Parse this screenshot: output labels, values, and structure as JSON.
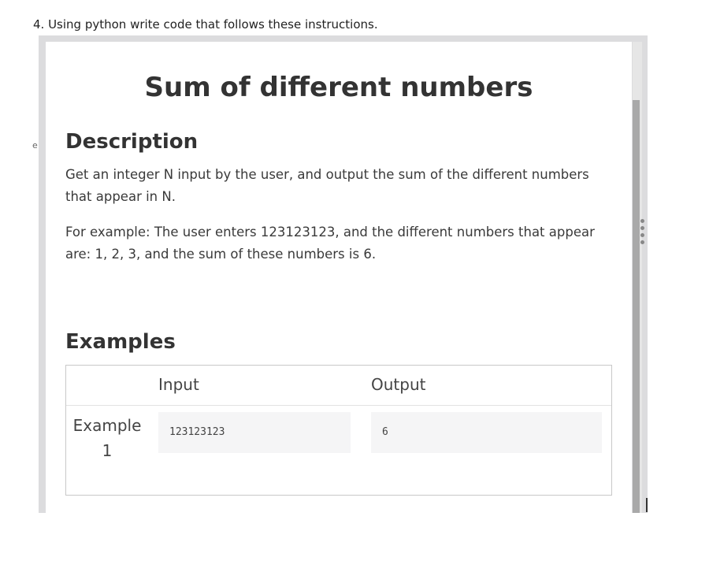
{
  "question": "4. Using python write code that follows these instructions.",
  "stray_letter": "e",
  "problem": {
    "title": "Sum of different numbers",
    "description_heading": "Description",
    "description_paragraphs": [
      "Get an integer N input by the user, and output the sum of the different numbers that appear in N.",
      "For example: The user enters 123123123, and the different numbers that appear are: 1, 2, 3, and the sum of these numbers is 6."
    ],
    "examples_heading": "Examples",
    "examples_table": {
      "headers": {
        "input": "Input",
        "output": "Output"
      },
      "rows": [
        {
          "label": "Example 1",
          "input": "123123123",
          "output": "6"
        }
      ]
    }
  }
}
